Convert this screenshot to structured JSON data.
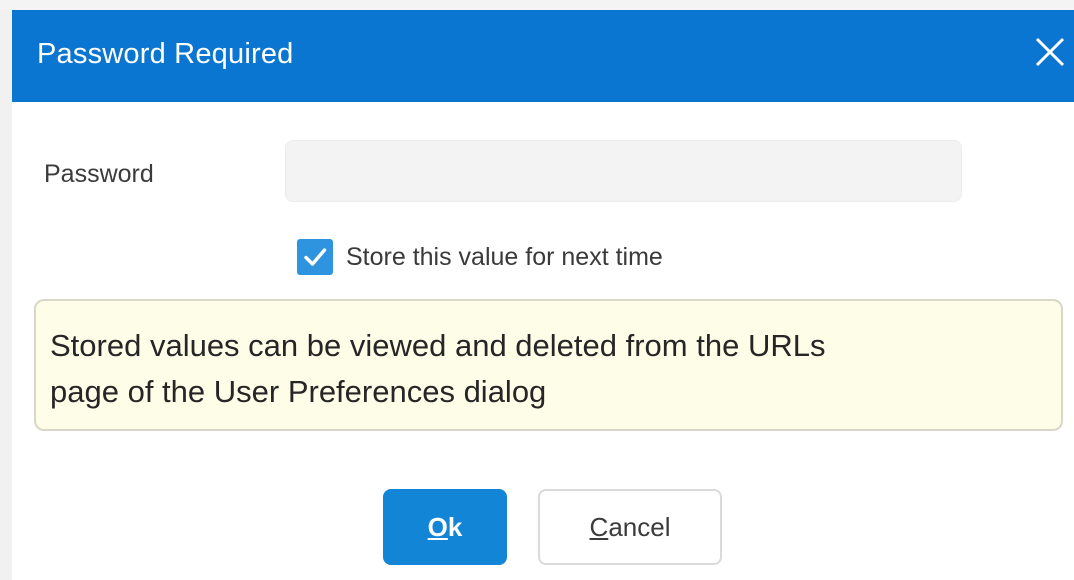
{
  "dialog": {
    "title": "Password Required",
    "close_icon": "close-icon"
  },
  "form": {
    "password_label": "Password",
    "password_value": "",
    "store_checkbox": {
      "checked": true,
      "label": "Store this value for next time"
    }
  },
  "info": {
    "line1": "Stored values can be viewed and deleted from the URLs",
    "line2": "page of the User Preferences dialog"
  },
  "buttons": {
    "ok": {
      "mnemonic": "O",
      "rest": "k"
    },
    "cancel": {
      "mnemonic": "C",
      "rest": "ancel"
    }
  },
  "colors": {
    "title_bar": "#0b76d1",
    "ok_button": "#1285d6",
    "checkbox": "#2f94e0",
    "info_background": "#fefde7"
  }
}
